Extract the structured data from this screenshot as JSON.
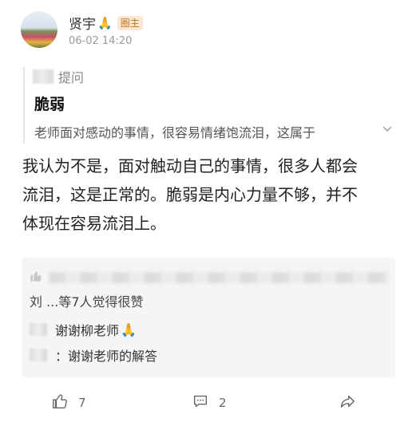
{
  "post": {
    "author": "贤宇",
    "badge": "圈主",
    "time": "06-02 14:20"
  },
  "quote": {
    "ask_label": "提问",
    "title": "脆弱",
    "excerpt": "老师面对感动的事情，很容易情绪饱流泪，这属于"
  },
  "answer": {
    "line1": "我认为不是，面对触动自己的事情，很多人都会",
    "line2": "流泪，这是正常的。脆弱是内心力量不够，并不",
    "line3": "体现在容易流泪上。"
  },
  "likes": {
    "summary": "刘 ...等7人觉得很赞"
  },
  "replies": [
    {
      "text": "谢谢柳老师"
    },
    {
      "text": "：谢谢老师的解答"
    }
  ],
  "actions": {
    "like_count": "7",
    "comment_count": "2"
  },
  "icons": [
    "thumbs-up-icon",
    "comment-icon",
    "share-icon",
    "chevron-down-icon",
    "pray-icon"
  ]
}
